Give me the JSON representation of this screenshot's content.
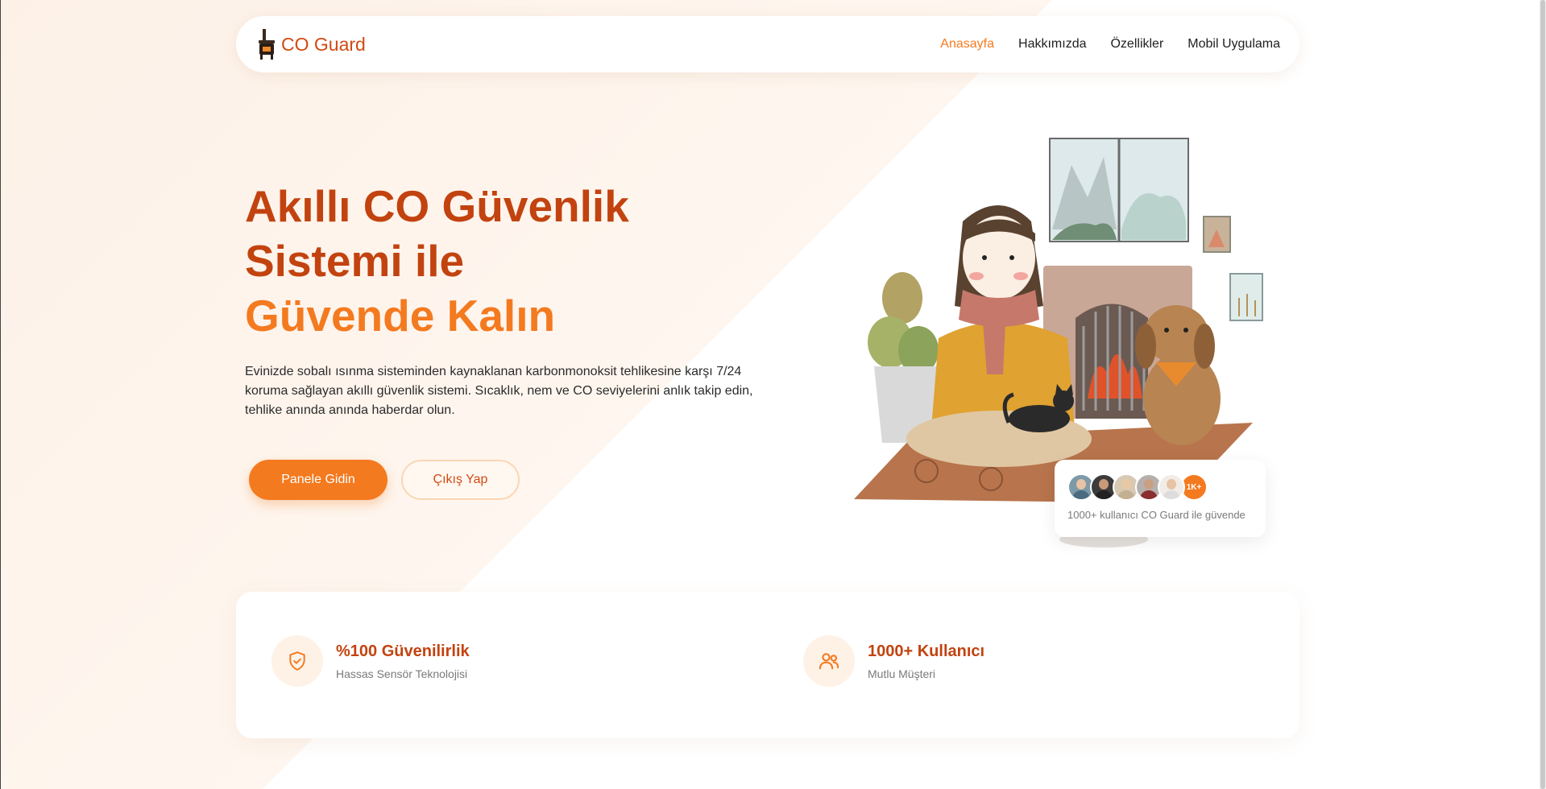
{
  "nav": {
    "brand": "CO Guard",
    "links": [
      {
        "label": "Anasayfa",
        "active": true
      },
      {
        "label": "Hakkımızda",
        "active": false
      },
      {
        "label": "Özellikler",
        "active": false
      },
      {
        "label": "Mobil Uygulama",
        "active": false
      }
    ]
  },
  "hero": {
    "title_line1": "Akıllı CO Güvenlik",
    "title_line2": "Sistemi ile",
    "title_accent": "Güvende Kalın",
    "description": "Evinizde sobalı ısınma sisteminden kaynaklanan karbonmonoksit tehlikesine karşı 7/24 koruma sağlayan akıllı güvenlik sistemi. Sıcaklık, nem ve CO seviyelerini anlık takip edin, tehlike anında anında haberdar olun.",
    "primary_button": "Panele Gidin",
    "secondary_button": "Çıkış Yap"
  },
  "users_card": {
    "count_badge": "1K+",
    "text": "1000+ kullanıcı CO Guard ile güvende"
  },
  "stats": [
    {
      "icon": "shield-check-icon",
      "title": "%100 Güvenilirlik",
      "subtitle": "Hassas Sensör Teknolojisi"
    },
    {
      "icon": "users-icon",
      "title": "1000+ Kullanıcı",
      "subtitle": "Mutlu Müşteri"
    }
  ],
  "colors": {
    "primary": "#f47a1f",
    "title": "#c2430f",
    "brand": "#d24a12"
  }
}
